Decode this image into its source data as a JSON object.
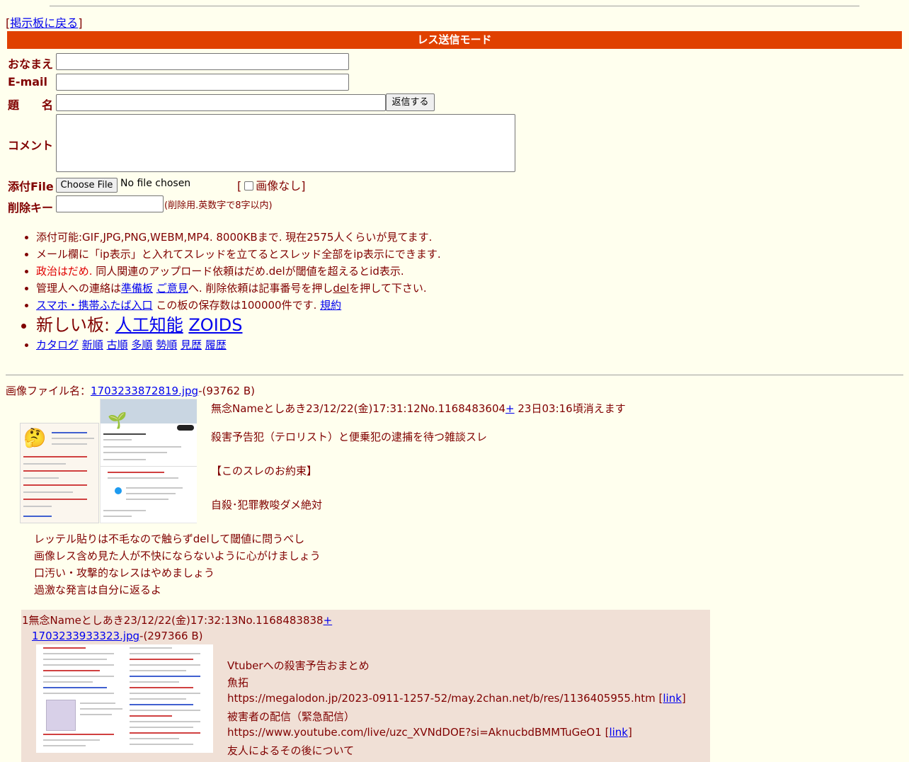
{
  "back": {
    "bracket_open": "[",
    "link": "掲示板に戻る",
    "bracket_close": "]"
  },
  "mode_title": "レス送信モード",
  "form": {
    "name_label": "おなまえ",
    "email_label": "E-mail",
    "subject_label": "題　　名",
    "comment_label": "コメント",
    "file_label": "添付File",
    "delkey_label": "削除キー",
    "submit_label": "返信する",
    "choose_file_label": "Choose File",
    "no_file_text": "No file chosen",
    "no_image_open": "[",
    "no_image_label": "画像なし",
    "no_image_close": "]",
    "delkey_note": "(削除用.英数字で8字以内)"
  },
  "rules": {
    "r1": "添付可能:GIF,JPG,PNG,WEBM,MP4. 8000KBまで. 現在2575人くらいが見てます.",
    "r2": "メール欄に「ip表示」と入れてスレッドを立てるとスレッド全部をip表示にできます.",
    "r3_red": "政治はだめ.",
    "r3_rest": " 同人関連のアップロード依頼はだめ.delが閾値を超えるとid表示.",
    "r4_pre": "管理人への連絡は",
    "r4_link1": "準備板",
    "r4_link2": "ご意見",
    "r4_mid": "へ. 削除依頼は記事番号を押し",
    "r4_del": "del",
    "r4_post": "を押して下さい.",
    "r5_link": "スマホ・携帯ふたば入口",
    "r5_mid": " この板の保存数は100000件です. ",
    "r5_link2": "規約",
    "r6_pre": "新しい板: ",
    "r6_link1": "人工知能",
    "r6_link2": "ZOIDS",
    "sort_links": [
      "カタログ",
      "新順",
      "古順",
      "多順",
      "勢順",
      "見歴",
      "履歴"
    ]
  },
  "op": {
    "file_label": "画像ファイル名：",
    "file_name": "1703233872819.jpg",
    "file_size": "-(93762 B)",
    "header": "無念Nameとしあき23/12/22(金)17:31:12No.1168483604",
    "plus": "+",
    "expire": "23日03:16頃消えます",
    "body1": "殺害予告犯（テロリスト）と便乗犯の逮捕を待つ雑談スレ",
    "body2": "【このスレのお約束】",
    "body3": "自殺･犯罪教唆ダメ絶対",
    "body4": "レッテル貼りは不毛なので触らずdelして閾値に問うべし",
    "body5": "画像レス含め見た人が不快にならないように心がけましょう",
    "body6": "口汚い・攻撃的なレスはやめましょう",
    "body7": "過激な発言は自分に返るよ"
  },
  "reply": {
    "header": "1無念Nameとしあき23/12/22(金)17:32:13No.1168483838",
    "plus": "+",
    "file_name": "1703233933323.jpg",
    "file_size": "-(297366 B)",
    "l1": "Vtuberへの殺害予告おまとめ",
    "l2": "魚拓",
    "l3": "https://megalodon.jp/2023-0911-1257-52/may.2chan.net/b/res/1136405955.htm",
    "l3_open": "[",
    "l3_link": "link",
    "l3_close": "]",
    "l4": "被害者の配信（緊急配信）",
    "l5": "https://www.youtube.com/live/uzc_XVNdDOE?si=AknucbdBMMTuGeO1",
    "l5_open": "[",
    "l5_link": "link",
    "l5_close": "]",
    "l6": "友人によるその後について"
  },
  "colors": {
    "bar": "#e04000",
    "bg": "#ffffee",
    "text": "#800000",
    "reply_bg": "#f0e0d6",
    "link": "#0000ee"
  }
}
